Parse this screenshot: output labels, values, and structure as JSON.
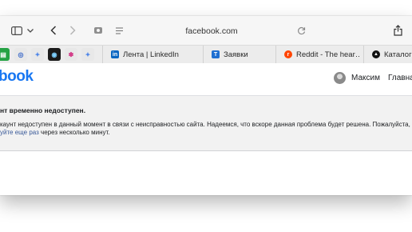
{
  "browser": {
    "url": "facebook.com",
    "tabs": [
      {
        "title": "Лента | LinkedIn",
        "favicon": "linkedin-icon",
        "color": "#0a66c2",
        "glyph": "in"
      },
      {
        "title": "Заявки",
        "favicon": "t-logo-icon",
        "color": "#1f6fd1",
        "glyph": "T"
      },
      {
        "title": "Reddit - The hear…",
        "favicon": "reddit-icon",
        "color": "#ff4500",
        "glyph": "r"
      },
      {
        "title": "Каталог г",
        "favicon": "triangle-logo-icon",
        "color": "#111111",
        "glyph": "▲"
      }
    ],
    "pinned_icons": [
      "pin-green-icon",
      "pin-globe-icon",
      "pin-star-icon",
      "pin-dark-icon",
      "pin-colorful-icon",
      "pin-sparkle-icon"
    ]
  },
  "header": {
    "logo": "book",
    "user_name": "Максим",
    "nav_link": "Главна"
  },
  "error": {
    "title": "нт временно недоступен.",
    "message": "каунт недоступен в данный момент в связи с неисправностью сайта. Надеемся, что вскоре данная проблема будет решена. Пожалуйста,",
    "retry_link": "уйте еще раз",
    "retry_suffix": " через несколько минут."
  }
}
